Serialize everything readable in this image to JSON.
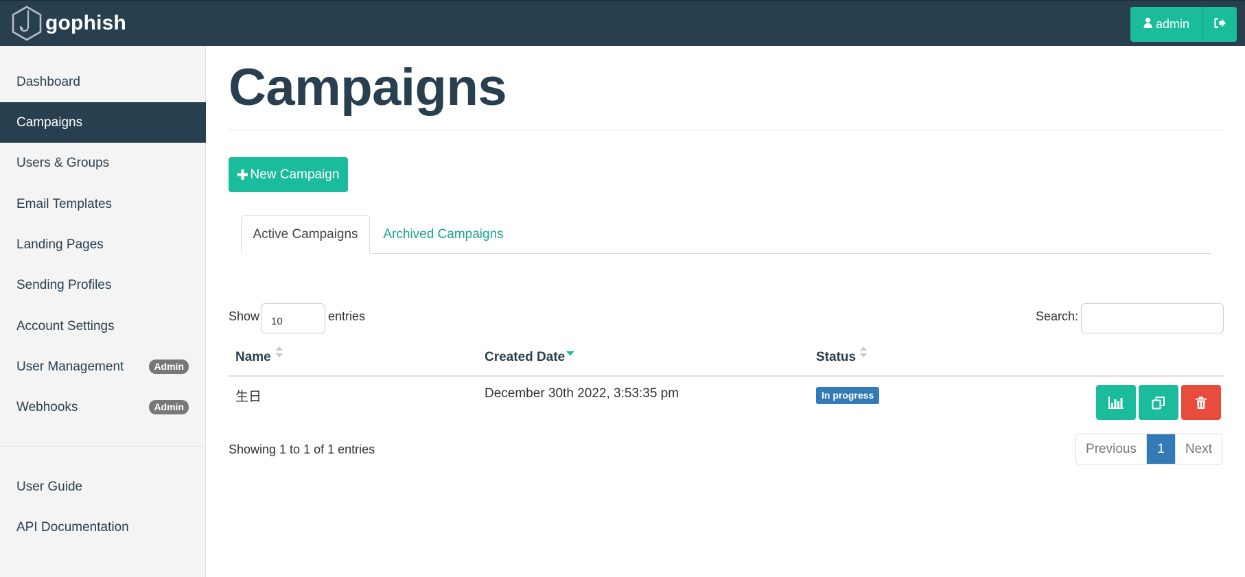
{
  "navbar": {
    "brand": "gophish",
    "user_label": "admin"
  },
  "sidebar": {
    "items": [
      {
        "label": "Dashboard"
      },
      {
        "label": "Campaigns"
      },
      {
        "label": "Users & Groups"
      },
      {
        "label": "Email Templates"
      },
      {
        "label": "Landing Pages"
      },
      {
        "label": "Sending Profiles"
      },
      {
        "label": "Account Settings"
      },
      {
        "label": "User Management",
        "badge": "Admin"
      },
      {
        "label": "Webhooks",
        "badge": "Admin"
      }
    ],
    "footer_items": [
      {
        "label": "User Guide"
      },
      {
        "label": "API Documentation"
      }
    ],
    "active_item": "Campaigns"
  },
  "main": {
    "title": "Campaigns",
    "new_button": "New Campaign",
    "tabs": [
      {
        "label": "Active Campaigns",
        "active": true
      },
      {
        "label": "Archived Campaigns",
        "active": false
      }
    ],
    "length": {
      "show": "Show",
      "value": "10",
      "entries": "entries"
    },
    "search_label": "Search:",
    "search_value": "",
    "table": {
      "columns": [
        "Name",
        "Created Date",
        "Status"
      ],
      "rows": [
        {
          "name": "生日",
          "created": "December 30th 2022, 3:53:35 pm",
          "status": "In progress"
        }
      ]
    },
    "info": "Showing 1 to 1 of 1 entries",
    "pagination": {
      "previous": "Previous",
      "current": "1",
      "next": "Next"
    }
  },
  "colors": {
    "navbar": "#283f50",
    "accent": "#1abc9c",
    "danger": "#e74c3c",
    "status_badge": "#337ab7",
    "badge_gray": "#777777"
  },
  "icons": {
    "brand": "hook-hexagon-logo",
    "user": "user-icon",
    "logout": "sign-out-icon",
    "new": "plus-icon",
    "results": "bar-chart-icon",
    "copy": "copy-icon",
    "delete": "trash-icon"
  }
}
